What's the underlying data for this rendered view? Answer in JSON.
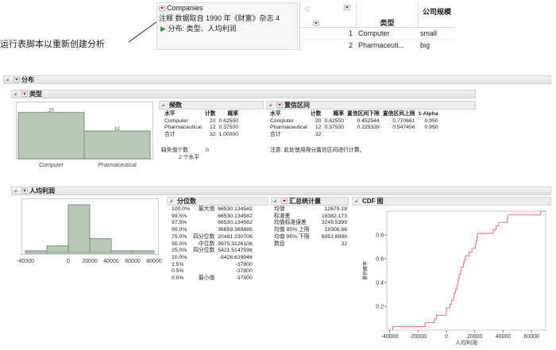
{
  "annotation": "运行表脚本以重新创建分析",
  "table_panel": {
    "title": "Companies",
    "note": "注释 数据取自 1990 年《财富》杂志 4",
    "script": "分布: 类型、人均利润"
  },
  "data_table": {
    "columns": [
      "类型",
      "公司规模"
    ],
    "rows": [
      {
        "n": "1",
        "type": "Computer",
        "size": "small"
      },
      {
        "n": "2",
        "type": "Pharmaceuti...",
        "size": "big"
      }
    ]
  },
  "report": {
    "title": "分布",
    "type_section": {
      "title": "类型",
      "chart_data": {
        "type": "bar",
        "categories": [
          "Computer",
          "Pharmaceutical"
        ],
        "values": [
          20,
          12
        ],
        "ylim": [
          0,
          24
        ]
      },
      "freq": {
        "title": "频数",
        "headers": [
          "水平",
          "计数",
          "概率"
        ],
        "rows": [
          [
            "Computer",
            "20",
            "0.62500"
          ],
          [
            "Pharmaceutical",
            "12",
            "0.37500"
          ],
          [
            "合计",
            "32",
            "1.00000"
          ]
        ],
        "missing_label": "缺失值个数",
        "missing": "0",
        "levels": "2 个水平"
      },
      "ci": {
        "title": "置信区间",
        "headers": [
          "水平",
          "计数",
          "概率",
          "置信区间下限",
          "置信区间上限",
          "1-Alpha"
        ],
        "rows": [
          [
            "Computer",
            "20",
            "0.62500",
            "0.452544",
            "0.770661",
            "0.950"
          ],
          [
            "Pharmaceutical",
            "12",
            "0.37500",
            "0.229339",
            "0.547456",
            "0.950"
          ],
          [
            "合计",
            "32",
            "",
            "",
            "",
            ""
          ]
        ],
        "note": "注意: 此处使用得分置信区间进行计算。"
      }
    },
    "profit_section": {
      "title": "人均利润",
      "chart_data": [
        {
          "type": "bar",
          "name": "histogram",
          "bin_edges": [
            -40000,
            -20000,
            0,
            20000,
            40000,
            60000,
            80000
          ],
          "values": [
            1,
            3,
            20,
            6,
            1,
            1
          ],
          "xticks": [
            "-40000",
            "0",
            "20000",
            "40000",
            "60000",
            "80000"
          ],
          "ylim": [
            0,
            21
          ]
        },
        {
          "type": "line",
          "name": "cdf",
          "title": "CDF 图",
          "xlabel": "人均利润",
          "ylabel": "累积概率",
          "xlim": [
            -42000,
            70000
          ],
          "ylim": [
            0,
            1
          ],
          "xticks": [
            "-40000",
            "-20000",
            "0",
            "20000",
            "40000",
            "60000"
          ],
          "yticks": [
            "0.2",
            "0.4",
            "0.6",
            "0.8"
          ],
          "x": [
            -37800,
            -15000,
            -8428.6,
            -7000,
            0,
            0,
            2500,
            3500,
            5000,
            5421.5,
            6500,
            7500,
            8000,
            8500,
            9000,
            9975.3,
            10500,
            12000,
            12500,
            13500,
            16000,
            18000,
            20481.3,
            21000,
            21500,
            22000,
            33000,
            35000,
            36859.4,
            43000,
            43500,
            66530.1
          ],
          "color": "#f07080"
        }
      ],
      "quantiles": {
        "title": "分位数",
        "rows": [
          [
            "100.0%",
            "最大值",
            "66530.134582"
          ],
          [
            "99.5%",
            "",
            "66530.134582"
          ],
          [
            "97.5%",
            "",
            "66530.134582"
          ],
          [
            "90.0%",
            "",
            "36859.369886"
          ],
          [
            "75.0%",
            "四分位数",
            "20481.330706"
          ],
          [
            "50.0%",
            "中位数",
            "9975.3126108"
          ],
          [
            "25.0%",
            "四分位数",
            "5421.5147598"
          ],
          [
            "10.0%",
            "",
            "-8428.629946"
          ],
          [
            "2.5%",
            "",
            "-37800"
          ],
          [
            "0.5%",
            "",
            "-37800"
          ],
          [
            "0.0%",
            "最小值",
            "-37800"
          ]
        ]
      },
      "summary": {
        "title": "汇总统计量",
        "rows": [
          [
            "均值",
            "12679.18"
          ],
          [
            "标准差",
            "18382.173"
          ],
          [
            "均值标准误差",
            "3249.5399"
          ],
          [
            "均值 95% 上限",
            "19306.66"
          ],
          [
            "均值 95% 下限",
            "6051.6998"
          ],
          [
            "数目",
            "32"
          ]
        ]
      }
    }
  },
  "colors": {
    "bar": "#b8c9b8",
    "bar_border": "#7d8f7d",
    "cdf": "#f07080"
  }
}
